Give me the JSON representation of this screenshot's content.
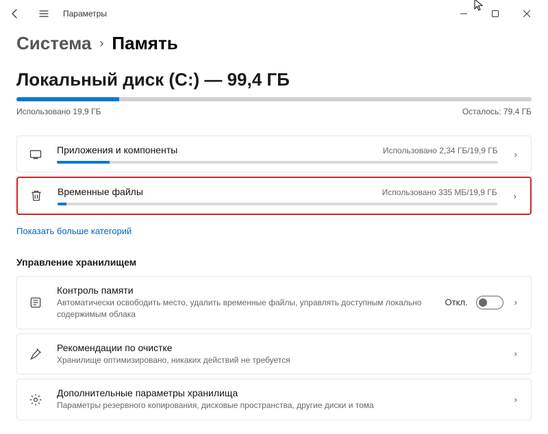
{
  "app_title": "Параметры",
  "breadcrumb": {
    "parent": "Система",
    "current": "Память"
  },
  "disk": {
    "title": "Локальный диск (C:) — 99,4 ГБ",
    "used_pct": 20,
    "used_label": "Использовано 19,9 ГБ",
    "free_label": "Осталось: 79,4 ГБ"
  },
  "categories": [
    {
      "icon": "apps",
      "title": "Приложения и компоненты",
      "usage": "Использовано 2,34 ГБ/19,9 ГБ",
      "pct": 12,
      "highlighted": false
    },
    {
      "icon": "trash",
      "title": "Временные файлы",
      "usage": "Использовано 335 МБ/19,9 ГБ",
      "pct": 2,
      "highlighted": true
    }
  ],
  "show_more": "Показать больше категорий",
  "storage_mgmt_header": "Управление хранилищем",
  "mgmt": [
    {
      "icon": "sense",
      "title": "Контроль памяти",
      "sub": "Автоматически освободить место, удалить временные файлы, управлять доступным локально содержимым облака",
      "toggle": true,
      "toggle_label": "Откл."
    },
    {
      "icon": "broom",
      "title": "Рекомендации по очистке",
      "sub": "Хранилище оптимизировано, никаких действий не требуется",
      "toggle": false
    },
    {
      "icon": "gear",
      "title": "Дополнительные параметры хранилища",
      "sub": "Параметры резервного копирования, дисковые пространства, другие диски и тома",
      "toggle": false
    }
  ]
}
